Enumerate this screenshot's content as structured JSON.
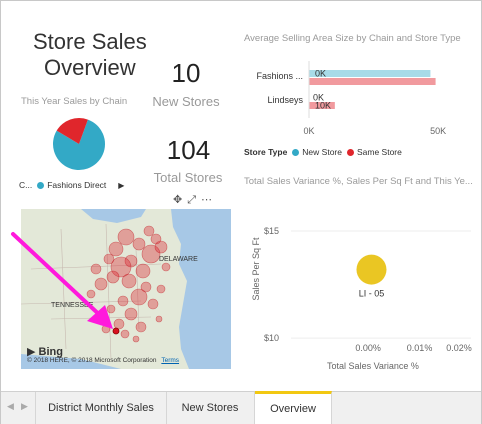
{
  "report_title": {
    "line1": "Store Sales",
    "line2": "Overview"
  },
  "cards": [
    {
      "value": "10",
      "label": "New Stores"
    },
    {
      "value": "104",
      "label": "Total Stores"
    }
  ],
  "pie": {
    "title": "This Year Sales by Chain",
    "legend_prefix": "C...",
    "legend_item": "Fashions Direct",
    "slices": [
      {
        "name": "Fashions Direct",
        "fraction": 0.78,
        "color": "#33a9c6"
      },
      {
        "name": "Lindseys",
        "fraction": 0.22,
        "color": "#e0262c"
      }
    ]
  },
  "map": {
    "bing_label": "Bing",
    "copyright": "© 2018 HERE, © 2018 Microsoft Corporation",
    "terms_link": "Terms",
    "place_labels": [
      "DELAWARE",
      "TENNESSEE"
    ]
  },
  "bar_chart": {
    "title": "Average Selling Area Size by Chain and Store Type",
    "legend_title": "Store Type",
    "legend": [
      {
        "name": "New Store",
        "color": "#33a9c6"
      },
      {
        "name": "Same Store",
        "color": "#e0262c"
      }
    ],
    "chart_data": {
      "type": "bar",
      "orientation": "horizontal",
      "categories": [
        "Fashions ...",
        "Lindseys"
      ],
      "series": [
        {
          "name": "New Store",
          "values": [
            47000,
            0
          ],
          "data_labels": [
            "0K",
            "0K"
          ],
          "color": "#a8dbe8"
        },
        {
          "name": "Same Store",
          "values": [
            49000,
            10000
          ],
          "data_labels": [
            "",
            "10K"
          ],
          "color": "#f19a9e"
        }
      ],
      "xlim": [
        0,
        60000
      ],
      "x_ticks": [
        "0K",
        "50K"
      ]
    }
  },
  "scatter": {
    "title": "Total Sales Variance %, Sales Per Sq Ft and This Ye...",
    "chart_data": {
      "type": "scatter",
      "xlabel": "Total Sales Variance %",
      "ylabel": "Sales Per Sq Ft",
      "x_ticks": [
        "0.00%",
        "0.01%",
        "0.02%"
      ],
      "y_ticks": [
        "$15",
        "$10"
      ],
      "xlim": [
        -0.00015,
        0.0002
      ],
      "ylim": [
        9.4,
        16.4
      ],
      "points": [
        {
          "x": 6.5e-06,
          "y": 13.2,
          "label": "LI - 05",
          "color": "#eac623"
        }
      ]
    }
  },
  "tabs": [
    {
      "label": "District Monthly Sales",
      "active": false
    },
    {
      "label": "New Stores",
      "active": false
    },
    {
      "label": "Overview",
      "active": true
    }
  ],
  "annotation_arrow_color": "#ff19dc"
}
